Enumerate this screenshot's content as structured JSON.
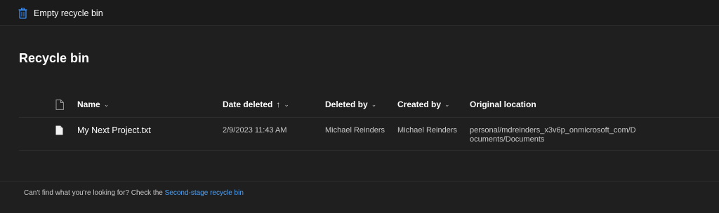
{
  "toolbar": {
    "empty_label": "Empty recycle bin",
    "empty_icon": "recycle-bin-icon"
  },
  "page": {
    "title": "Recycle bin"
  },
  "columns": {
    "file_type_icon": "file-type-icon",
    "name": "Name",
    "date_deleted": "Date deleted",
    "date_deleted_sort": "↑",
    "deleted_by": "Deleted by",
    "created_by": "Created by",
    "original_location": "Original location"
  },
  "rows": [
    {
      "icon": "document-icon",
      "name": "My Next Project.txt",
      "date_deleted": "2/9/2023 11:43 AM",
      "deleted_by": "Michael Reinders",
      "created_by": "Michael Reinders",
      "original_location": "personal/mdreinders_x3v6p_onmicrosoft_com/Documents/Documents"
    }
  ],
  "footer": {
    "prompt": "Can't find what you're looking for? Check the ",
    "link": "Second-stage recycle bin"
  },
  "colors": {
    "background": "#1f1f1f",
    "accent_link": "#4ea1f5",
    "icon_blue": "#2f7fe0"
  }
}
